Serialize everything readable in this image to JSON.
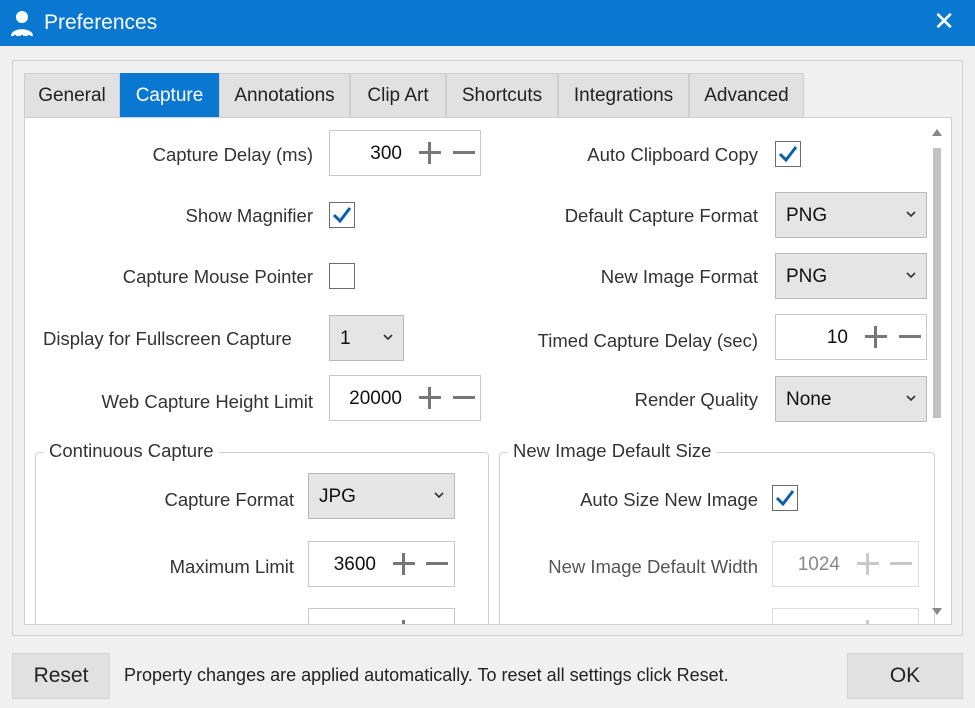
{
  "window": {
    "title": "Preferences",
    "app_icon": "user-icon",
    "close_icon": "close-icon",
    "accent": "#0a78d0"
  },
  "tabs": [
    {
      "label": "General",
      "active": false
    },
    {
      "label": "Capture",
      "active": true
    },
    {
      "label": "Annotations",
      "active": false
    },
    {
      "label": "Clip Art",
      "active": false
    },
    {
      "label": "Shortcuts",
      "active": false
    },
    {
      "label": "Integrations",
      "active": false
    },
    {
      "label": "Advanced",
      "active": false
    }
  ],
  "left": {
    "capture_delay": {
      "label": "Capture Delay (ms)",
      "value": "300"
    },
    "show_magnifier": {
      "label": "Show Magnifier",
      "checked": true
    },
    "capture_mouse_pointer": {
      "label": "Capture Mouse Pointer",
      "checked": false
    },
    "display_fullscreen": {
      "label": "Display for Fullscreen Capture",
      "value": "1"
    },
    "web_capture_height": {
      "label": "Web Capture Height Limit",
      "value": "20000"
    }
  },
  "right": {
    "auto_clipboard_copy": {
      "label": "Auto Clipboard Copy",
      "checked": true
    },
    "default_capture_format": {
      "label": "Default Capture Format",
      "value": "PNG"
    },
    "new_image_format": {
      "label": "New Image Format",
      "value": "PNG"
    },
    "timed_capture_delay": {
      "label": "Timed Capture Delay (sec)",
      "value": "10"
    },
    "render_quality": {
      "label": "Render Quality",
      "value": "None"
    }
  },
  "continuous_capture": {
    "title": "Continuous Capture",
    "capture_format": {
      "label": "Capture Format",
      "value": "JPG"
    },
    "maximum_limit": {
      "label": "Maximum Limit",
      "value": "3600"
    }
  },
  "new_image_default_size": {
    "title": "New Image Default Size",
    "auto_size": {
      "label": "Auto Size New Image",
      "checked": true
    },
    "default_width": {
      "label": "New Image Default Width",
      "value": "1024",
      "disabled": true
    }
  },
  "footer": {
    "reset_label": "Reset",
    "status_text": "Property changes are applied automatically. To reset all settings click Reset.",
    "ok_label": "OK"
  }
}
